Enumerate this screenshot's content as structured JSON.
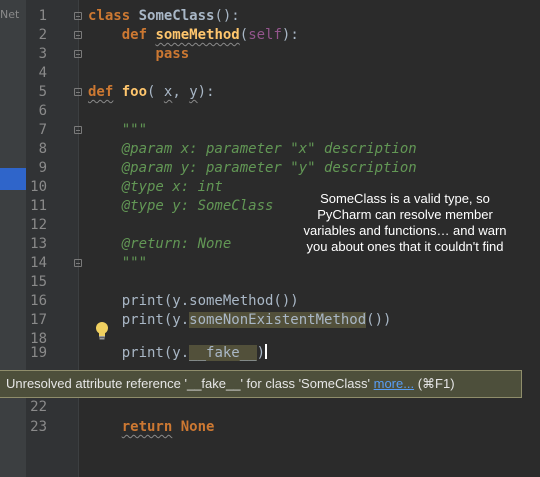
{
  "sidebar": {
    "tab_text": "Net"
  },
  "lines": [
    {
      "n": "1"
    },
    {
      "n": "2"
    },
    {
      "n": "3"
    },
    {
      "n": "4"
    },
    {
      "n": "5"
    },
    {
      "n": "6"
    },
    {
      "n": "7"
    },
    {
      "n": "8"
    },
    {
      "n": "9"
    },
    {
      "n": "10"
    },
    {
      "n": "11"
    },
    {
      "n": "12"
    },
    {
      "n": "13"
    },
    {
      "n": "14"
    },
    {
      "n": "15"
    },
    {
      "n": "16"
    },
    {
      "n": "17"
    },
    {
      "n": "18"
    },
    {
      "n": "19"
    },
    {
      "n": "22"
    },
    {
      "n": "23"
    }
  ],
  "code": {
    "l1_kw": "class",
    "l1_name": "SomeClass",
    "l1_rest": "():",
    "l2_kw": "def",
    "l2_name": "someMethod",
    "l2_open": "(",
    "l2_self": "self",
    "l2_close": "):",
    "l3_kw": "pass",
    "l5_kw": "def",
    "l5_name": "foo",
    "l5_open": "(",
    "l5_x": "x",
    "l5_sep": ", ",
    "l5_y": "y",
    "l5_close": "):",
    "l7": "\"\"\"",
    "l8": "@param x: parameter \"x\" description",
    "l9": "@param y: parameter \"y\" description",
    "l10": "@type x: int",
    "l11": "@type y: SomeClass",
    "l13": "@return: None",
    "l14": "\"\"\"",
    "l16": "print(y.someMethod())",
    "l17_a": "print(y.",
    "l17_b": "someNonExistentMethod",
    "l17_c": "())",
    "l19_a": "print(y.",
    "l19_b": "__fake__",
    "l19_c": ")",
    "l23_kw": "return",
    "l23_val": "None"
  },
  "annotation": {
    "text": "SomeClass is a valid type, so PyCharm can resolve member variables and functions… and warn you about ones that it couldn't find"
  },
  "tooltip": {
    "message": "Unresolved attribute reference '__fake__' for class 'SomeClass' ",
    "link": "more...",
    "shortcut": " (⌘F1)"
  },
  "colors": {
    "background": "#2b2b2b",
    "keyword": "#cc7832",
    "function": "#ffc66d",
    "docstring": "#629755",
    "self": "#94558d",
    "link": "#589df6"
  },
  "icons": [
    "lightbulb-icon",
    "fold-icon"
  ]
}
